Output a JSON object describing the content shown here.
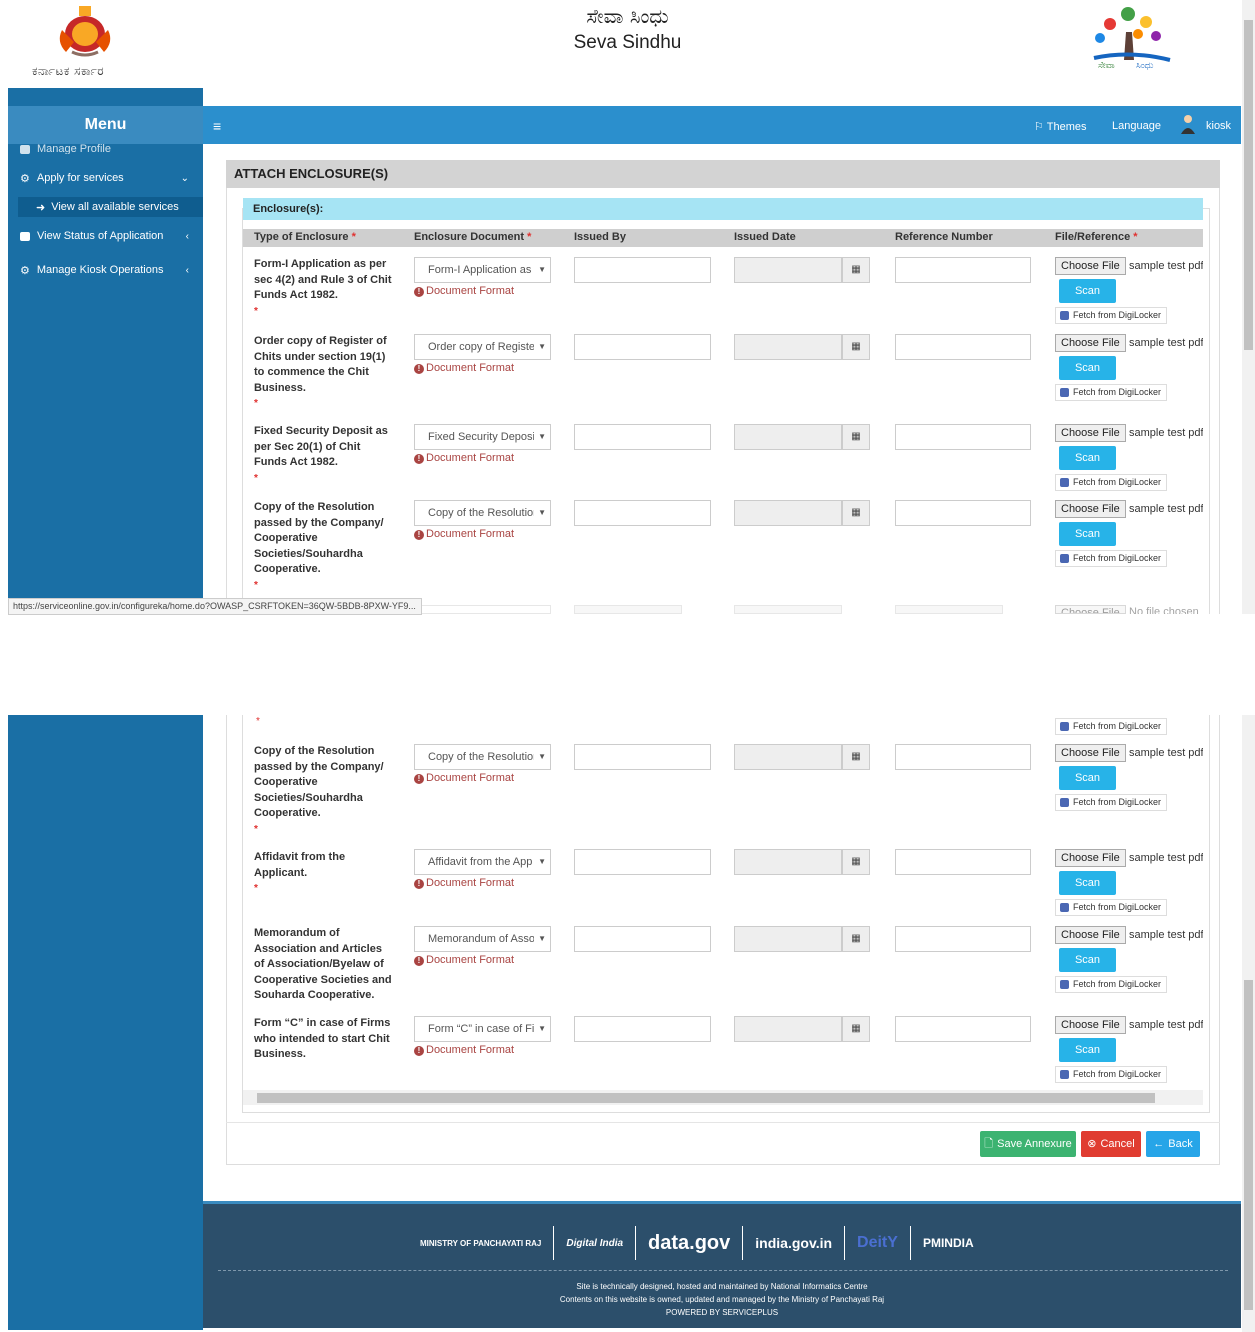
{
  "header": {
    "gov_text": "ಕರ್ನಾಟಕ ಸರ್ಕಾರ",
    "title_kannada": "ಸೇವಾ ಸಿಂಧು",
    "title_english": "Seva Sindhu",
    "logo_text": "ಸೇವಾ ಸಿಂಧು"
  },
  "topbar": {
    "themes": "Themes",
    "language": "Language",
    "user": "kiosk"
  },
  "sidebar": {
    "menu_title": "Menu",
    "items": [
      {
        "label": "Manage Profile"
      },
      {
        "label": "Apply for services"
      },
      {
        "label": "View all available services"
      },
      {
        "label": "View Status of Application"
      },
      {
        "label": "Manage Kiosk Operations"
      }
    ]
  },
  "panel": {
    "title": "ATTACH ENCLOSURE(S)",
    "section_title": "Enclosure(s):",
    "columns": [
      "Type of Enclosure",
      "Enclosure Document",
      "Issued By",
      "Issued Date",
      "Reference Number",
      "File/Reference"
    ]
  },
  "common": {
    "document_format": "Document Format",
    "choose_file": "Choose File",
    "file_name": "sample test pdf.pdf",
    "no_file": "No file chosen",
    "scan": "Scan",
    "fetch_digilocker": "Fetch from DigiLocker",
    "required_mark": "*"
  },
  "rows_top": [
    {
      "type": "Form-I Application as per sec 4(2) and Rule 3 of Chit Funds Act 1982.",
      "doc": "Form-I Application as"
    },
    {
      "type": "Order copy of Register of Chits under section 19(1) to commence the Chit Business.",
      "doc": "Order copy of Register"
    },
    {
      "type": "Fixed Security Deposit as per Sec 20(1) of Chit Funds Act 1982.",
      "doc": "Fixed Security Deposit"
    },
    {
      "type": "Copy of the Resolution passed by the Company/ Cooperative Societies/Souhardha Cooperative.",
      "doc": "Copy of the Resolution"
    }
  ],
  "rows_bottom": [
    {
      "type": "Copy of the Resolution passed by the Company/ Cooperative Societies/Souhardha Cooperative.",
      "doc": "Copy of the Resolution"
    },
    {
      "type": "Affidavit from the Applicant.",
      "doc": "Affidavit from the App"
    },
    {
      "type": "Memorandum of Association and Articles of Association/Byelaw of Cooperative Societies and Souharda Cooperative.",
      "doc": "Memorandum of Asso"
    },
    {
      "type": "Form “C” in case of Firms who intended to start Chit Business.",
      "doc": "Form “C” in case of Fir"
    }
  ],
  "status_url": "https://serviceonline.gov.in/configureka/home.do?OWASP_CSRFTOKEN=36QW-5BDB-8PXW-YF9...",
  "buttons": {
    "save": "Save Annexure",
    "cancel": "Cancel",
    "back": "Back"
  },
  "footer": {
    "logos": [
      "MINISTRY OF PANCHAYATI RAJ",
      "Digital India",
      "data.gov",
      "india.gov.in",
      "DeitY",
      "PMINDIA"
    ],
    "line1": "Site is technically designed, hosted and maintained by National Informatics Centre",
    "line2": "Contents on this website is owned, updated and managed by the Ministry of Panchayati Raj",
    "line3": "POWERED BY SERVICEPLUS"
  },
  "colors": {
    "sidebar": "#1a6fa5",
    "topbar": "#2b8fcd",
    "section_header": "#a6e4f4",
    "scan": "#27b3e8",
    "save": "#3cb371",
    "cancel": "#e03c31",
    "back": "#27a5e8",
    "footer": "#2c4f6b"
  }
}
